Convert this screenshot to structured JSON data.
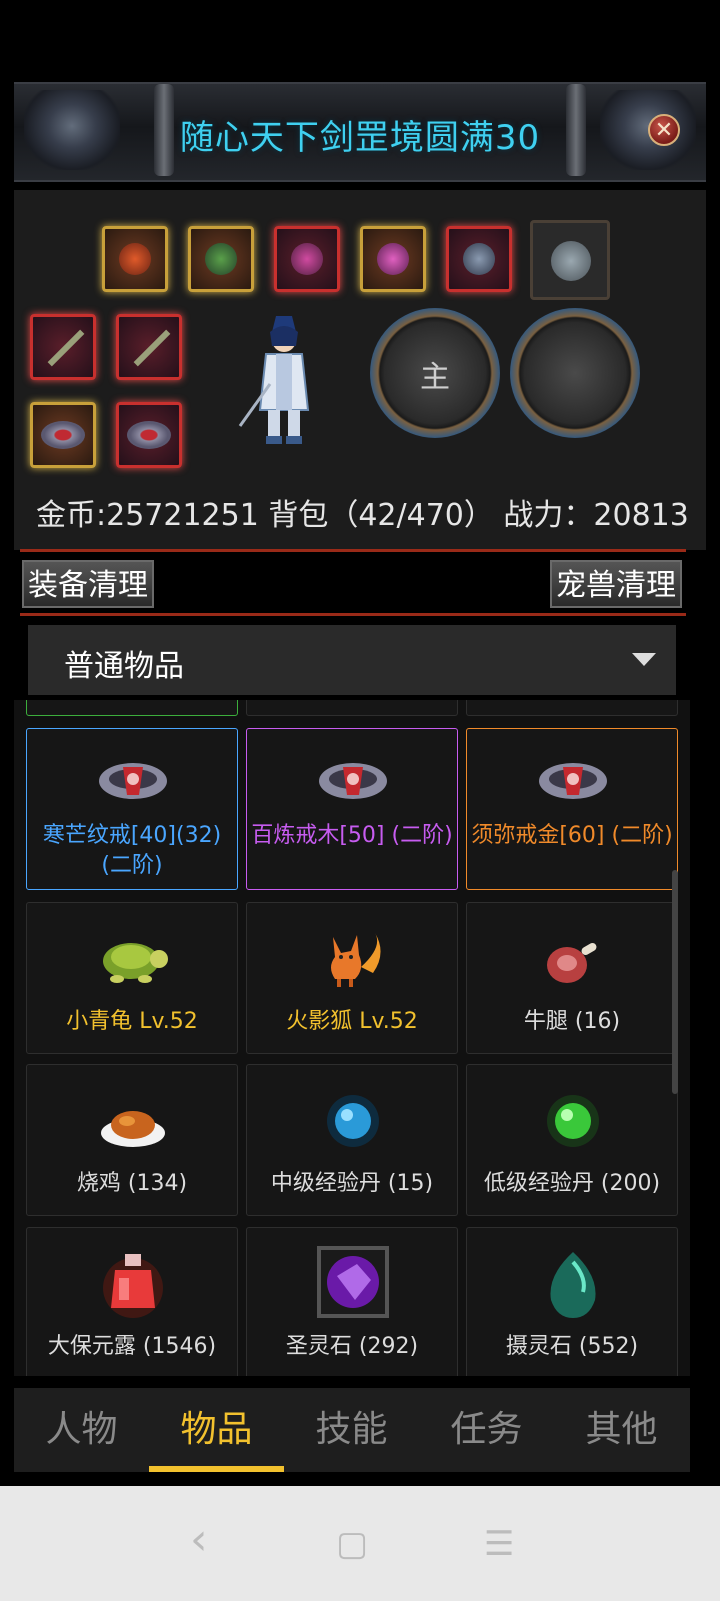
{
  "banner": {
    "title": "随心天下剑罡境圆满30",
    "close_label": "✕"
  },
  "hero_panel": {
    "main_label": "主",
    "stats_text": "金币:25721251 背包（42/470） 战力：20813"
  },
  "buttons": {
    "equip_clean": "装备清理",
    "pet_clean": "宠兽清理"
  },
  "category": {
    "selected": "普通物品"
  },
  "items": [
    {
      "name": "寒芒纹戒[40](32) (二阶)",
      "color": "#4aa6ff",
      "icon": "ring-icon"
    },
    {
      "name": "百炼戒木[50] (二阶)",
      "color": "#c75cf0",
      "icon": "ring-icon"
    },
    {
      "name": "须弥戒金[60] (二阶)",
      "color": "#f08a2a",
      "icon": "ring-icon"
    },
    {
      "name": "小青龟 Lv.52",
      "color": "#f2c12e",
      "icon": "turtle-icon"
    },
    {
      "name": "火影狐 Lv.52",
      "color": "#f2c12e",
      "icon": "fox-icon"
    },
    {
      "name": "牛腿 (16)",
      "color": "#dddddd",
      "icon": "meat-icon"
    },
    {
      "name": "烧鸡 (134)",
      "color": "#dddddd",
      "icon": "roast-chicken-icon"
    },
    {
      "name": "中级经验丹 (15)",
      "color": "#dddddd",
      "icon": "blue-orb-icon"
    },
    {
      "name": "低级经验丹 (200)",
      "color": "#dddddd",
      "icon": "green-orb-icon"
    },
    {
      "name": "大保元露 (1546)",
      "color": "#dddddd",
      "icon": "potion-icon"
    },
    {
      "name": "圣灵石 (292)",
      "color": "#dddddd",
      "icon": "purple-crystal-icon"
    },
    {
      "name": "摄灵石 (552)",
      "color": "#dddddd",
      "icon": "green-egg-icon"
    }
  ],
  "tabs": [
    "人物",
    "物品",
    "技能",
    "任务",
    "其他"
  ],
  "active_tab": "物品",
  "system_nav": {
    "back": "‹",
    "home": "▢",
    "menu": "☰"
  }
}
